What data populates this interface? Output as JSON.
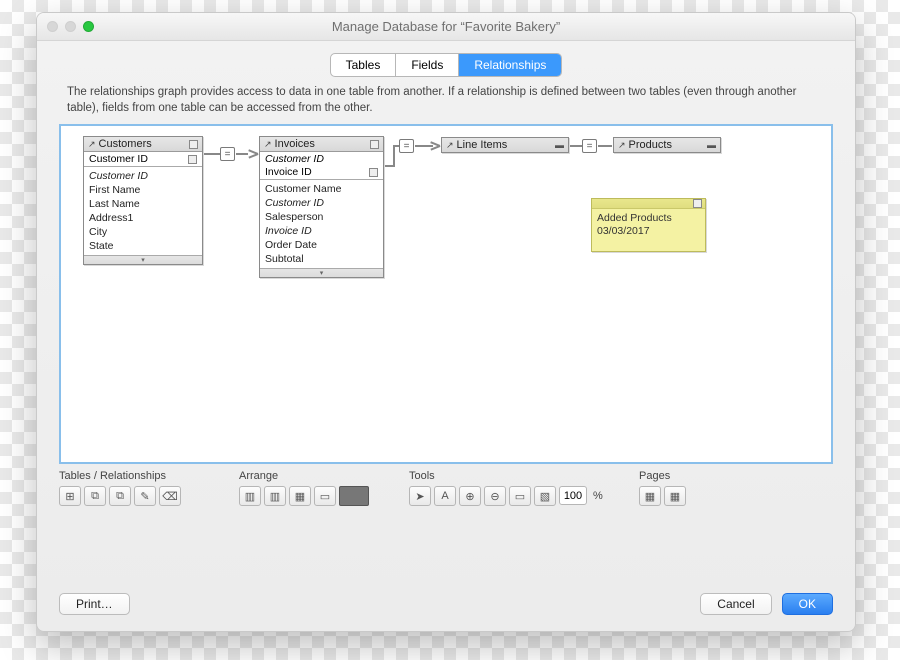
{
  "window": {
    "title": "Manage Database for “Favorite Bakery”"
  },
  "tabs": {
    "tables": "Tables",
    "fields": "Fields",
    "relationships": "Relationships",
    "selected": "relationships"
  },
  "help_text": "The relationships graph provides access to data in one table from another. If a relationship is defined between two tables (even through another table), fields from one table can be accessed from the other.",
  "graph": {
    "tables": {
      "customers": {
        "name": "Customers",
        "key_field": "Customer ID",
        "fields": [
          "Customer ID",
          "First Name",
          "Last Name",
          "Address1",
          "City",
          "State"
        ],
        "italic_fields": [
          "Customer ID"
        ]
      },
      "invoices": {
        "name": "Invoices",
        "key_fields": [
          "Customer ID",
          "Invoice ID"
        ],
        "fields": [
          "Customer Name",
          "Customer ID",
          "Salesperson",
          "Invoice ID",
          "Order Date",
          "Subtotal"
        ],
        "italic_fields": [
          "Customer ID",
          "Invoice ID"
        ]
      },
      "line_items": {
        "name": "Line Items"
      },
      "products": {
        "name": "Products"
      }
    },
    "note": {
      "line1": "Added Products",
      "line2": "03/03/2017"
    },
    "join_symbol": "="
  },
  "toolbar": {
    "tables_label": "Tables / Relationships",
    "arrange_label": "Arrange",
    "tools_label": "Tools",
    "pages_label": "Pages",
    "zoom_value": "100",
    "zoom_suffix": "%"
  },
  "footer": {
    "print": "Print…",
    "cancel": "Cancel",
    "ok": "OK"
  }
}
